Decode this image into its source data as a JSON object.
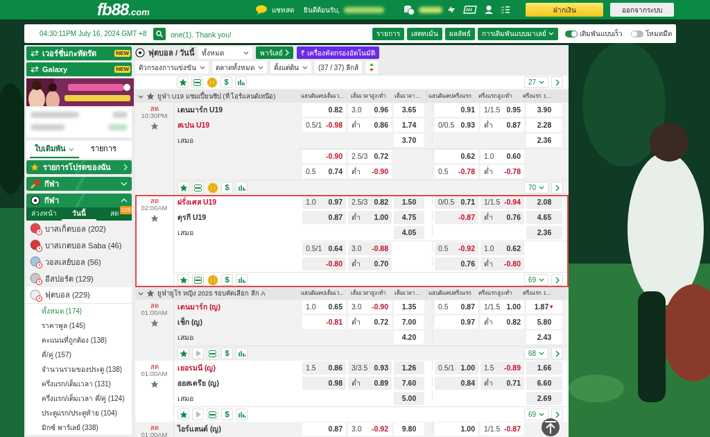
{
  "header": {
    "logo": {
      "main": "fb88",
      "suffix": ".com"
    },
    "chat": "แชทสด",
    "welcome": "ยินดีต้อนรับ,",
    "deposit": "ฝากเงิน",
    "logout": "ออกจากระบบ"
  },
  "topbar": {
    "clock": "04:30:11PM July 16, 2024 GMT +8",
    "marquee": "one(1). Thank you!",
    "buttons": [
      "รายการ",
      "เสตทเม้น",
      "ผลลัพธ์"
    ],
    "odds_type": "การเดิมพันแบบมาเลย์",
    "toggles": [
      {
        "label": "เดิมพันแบบเร็ว",
        "on": true
      },
      {
        "label": "โหมดมืด",
        "on": false
      }
    ]
  },
  "sidebar": {
    "promos": [
      {
        "label": "เวอร์ชั่นกะทัดรัด",
        "badge": "NEW"
      },
      {
        "label": "Galaxy",
        "badge": "NEW"
      }
    ],
    "slip_tabs": [
      {
        "label": "ใบเดิมพัน",
        "selected": true
      },
      {
        "label": "รายการ",
        "selected": false
      }
    ],
    "panels": [
      {
        "label": "รายการโปรดของฉัน",
        "kind": "link"
      },
      {
        "label": "กีฬา",
        "kind": "collapsible",
        "expanded": false
      },
      {
        "label": "กีฬา",
        "kind": "collapsible",
        "expanded": true
      }
    ],
    "period_tabs": [
      {
        "label": "ล่วงหน้า",
        "selected": false
      },
      {
        "label": "วันนี้",
        "selected": true
      },
      {
        "label": "สด",
        "selected": false,
        "badge": "125"
      }
    ],
    "sports": [
      {
        "name": "บาสเก็ตบอล",
        "count": "(202)",
        "expanded": false
      },
      {
        "name": "บาสเกตบอล Saba",
        "count": "(46)",
        "expanded": false
      },
      {
        "name": "วอลเลย์บอล",
        "count": "(56)",
        "expanded": false
      },
      {
        "name": "อีสปอร์ต",
        "count": "(129)",
        "expanded": false
      },
      {
        "name": "ฟุตบอล",
        "count": "(229)",
        "expanded": true,
        "children": [
          {
            "label": "ทั้งหมด (174)",
            "selected": true
          },
          {
            "label": "ราคาพูล (145)",
            "selected": false
          },
          {
            "label": "คะแนนที่ถูกต้อง (138)",
            "selected": false
          },
          {
            "label": "คี่/คู่ (157)",
            "selected": false
          },
          {
            "label": "จำนวนรวมของประตู (138)",
            "selected": false
          },
          {
            "label": "ครึ่งแรก/เต็มเวลา (131)",
            "selected": false
          },
          {
            "label": "ครึ่งแรก/เต็มเวลา คี่/คู่ (124)",
            "selected": false
          },
          {
            "label": "ประตูแรก/ประตูท้าย (104)",
            "selected": false
          },
          {
            "label": "มิกซ์ พาร์เลย์ (338)",
            "selected": false
          }
        ]
      }
    ]
  },
  "filters": {
    "sport_title": "ฟุตบอล / วันนี้",
    "market_select": "ทั้งหมด",
    "parlay": "พาร์เลย์",
    "auto_filter_symbol": "₹",
    "auto_filter": "เครื่องคัดกรองอัตโนมัติ",
    "dropdowns": [
      "ตัวกรองการแข่งขัน",
      "ตลาดทั้งหมด",
      "ตั้งแต่ต้น"
    ],
    "league_count": "(37 / 37) ลีกส์"
  },
  "toolbar": {
    "price_symbol": "$",
    "page_size": "27"
  },
  "leagues": [
    {
      "name": "ยูฟ่า U19 แชมเปี้ยนชิป (ที่ ไอร์แลนด์เหนือ)",
      "columns": [
        "แฮนดิแคปเต็มเว...",
        "เต็มเวลาสูง/ต่ำ",
        "เต็มเวลา ...",
        "แฮนดิแคปครึ่งแรก",
        "ครึ่งแรกสูง/ต่ำ",
        "ครึ่งแรก 1..."
      ],
      "matches": [
        {
          "status": "สด",
          "time": "10:30PM",
          "selected": false,
          "teams": [
            {
              "name": "เดนมาร์ก U19",
              "favorite": false
            },
            {
              "name": "สเปน U19",
              "favorite": true
            }
          ],
          "draw": "เสมอ",
          "streaming": false,
          "cash_out": true,
          "price_symbol": "$",
          "markets": "70",
          "blocks": [
            [
              {
                "ft_hdp": {
                  "odds": "0.82",
                  "negative": false
                },
                "ft_ou": {
                  "line": "3.0",
                  "odds": "0.96",
                  "negative": false
                },
                "ft_1x2": {
                  "odds": "3.65",
                  "negative": false
                },
                "ht_hdp": {
                  "odds": "0.91",
                  "negative": false
                },
                "ht_ou": {
                  "line": "1/1.5",
                  "odds": "0.95",
                  "negative": false
                },
                "ht_1x2": {
                  "odds": "3.90",
                  "negative": false
                }
              },
              {
                "ft_hdp": {
                  "line": "0.5/1",
                  "odds": "-0.98",
                  "negative": true
                },
                "ft_ou": {
                  "line": "ต่ำ",
                  "odds": "0.86",
                  "negative": false
                },
                "ft_1x2": {
                  "odds": "1.74",
                  "negative": false
                },
                "ht_hdp": {
                  "line": "0/0.5",
                  "odds": "0.93",
                  "negative": false
                },
                "ht_ou": {
                  "line": "ต่ำ",
                  "odds": "0.87",
                  "negative": false
                },
                "ht_1x2": {
                  "odds": "2.28",
                  "negative": false
                }
              },
              {
                "ft_1x2": {
                  "odds": "3.70",
                  "negative": false
                },
                "ht_1x2": {
                  "odds": "2.36",
                  "negative": false
                }
              }
            ],
            [
              {
                "ft_hdp": {
                  "odds": "-0.90",
                  "negative": true
                },
                "ft_ou": {
                  "line": "2.5/3",
                  "odds": "0.72",
                  "negative": false
                },
                "ht_hdp": {
                  "odds": "0.62",
                  "negative": false
                },
                "ht_ou": {
                  "line": "1.0",
                  "odds": "0.60",
                  "negative": false
                }
              },
              {
                "ft_hdp": {
                  "line": "0.5",
                  "odds": "0.74",
                  "negative": false
                },
                "ft_ou": {
                  "line": "ต่ำ",
                  "odds": "-0.90",
                  "negative": true
                },
                "ht_hdp": {
                  "line": "0.5",
                  "odds": "-0.78",
                  "negative": true
                },
                "ht_ou": {
                  "line": "ต่ำ",
                  "odds": "-0.78",
                  "negative": true
                }
              }
            ]
          ]
        },
        {
          "status": "สด",
          "time": "02:00AM",
          "selected": true,
          "teams": [
            {
              "name": "ฝรั่งเศส U19",
              "favorite": true
            },
            {
              "name": "ตุรกี U19",
              "favorite": false
            }
          ],
          "draw": "เสมอ",
          "streaming": false,
          "cash_out": true,
          "price_symbol": "$",
          "markets": "69",
          "blocks": [
            [
              {
                "ft_hdp": {
                  "line": "1.0",
                  "odds": "0.97",
                  "negative": false
                },
                "ft_ou": {
                  "line": "2.5/3",
                  "odds": "0.82",
                  "negative": false
                },
                "ft_1x2": {
                  "odds": "1.50",
                  "negative": false
                },
                "ht_hdp": {
                  "line": "0/0.5",
                  "odds": "0.71",
                  "negative": false
                },
                "ht_ou": {
                  "line": "1/1.5",
                  "odds": "-0.94",
                  "negative": true
                },
                "ht_1x2": {
                  "odds": "2.08",
                  "negative": false
                }
              },
              {
                "ft_hdp": {
                  "odds": "0.87",
                  "negative": false
                },
                "ft_ou": {
                  "line": "ต่ำ",
                  "odds": "1.00",
                  "negative": false
                },
                "ft_1x2": {
                  "odds": "4.75",
                  "negative": false
                },
                "ht_hdp": {
                  "odds": "-0.87",
                  "negative": true
                },
                "ht_ou": {
                  "line": "ต่ำ",
                  "odds": "0.76",
                  "negative": false
                },
                "ht_1x2": {
                  "odds": "4.65",
                  "negative": false
                }
              },
              {
                "ft_1x2": {
                  "odds": "4.05",
                  "negative": false
                },
                "ht_1x2": {
                  "odds": "2.36",
                  "negative": false
                }
              }
            ],
            [
              {
                "ft_hdp": {
                  "line": "0.5/1",
                  "odds": "0.64",
                  "negative": false
                },
                "ft_ou": {
                  "line": "3.0",
                  "odds": "-0.88",
                  "negative": true
                },
                "ht_hdp": {
                  "line": "0.5",
                  "odds": "-0.92",
                  "negative": true
                },
                "ht_ou": {
                  "line": "1.0",
                  "odds": "0.62",
                  "negative": false
                }
              },
              {
                "ft_hdp": {
                  "odds": "-0.80",
                  "negative": true
                },
                "ft_ou": {
                  "line": "ต่ำ",
                  "odds": "0.70",
                  "negative": false
                },
                "ht_hdp": {
                  "odds": "0.76",
                  "negative": false
                },
                "ht_ou": {
                  "line": "ต่ำ",
                  "odds": "-0.80",
                  "negative": true
                }
              }
            ]
          ]
        }
      ]
    },
    {
      "name": "ยูฟ่ายูโร หญิง 2025 รอบคัดเลือก ลีก A",
      "columns": [
        "แฮนดิแคปเต็มเว...",
        "เต็มเวลาสูง/ต่ำ",
        "เต็มเวลา ...",
        "แฮนดิแคปครึ่งแรก",
        "ครึ่งแรกสูง/ต่ำ",
        "ครึ่งแรก 1..."
      ],
      "matches": [
        {
          "status": "สด",
          "time": "01:00AM",
          "selected": false,
          "teams": [
            {
              "name": "เดนมาร์ก (ญ)",
              "favorite": true
            },
            {
              "name": "เช็ก (ญ)",
              "favorite": false
            }
          ],
          "draw": "เสมอ",
          "streaming": true,
          "cash_out": false,
          "price_symbol": "$",
          "markets": "68",
          "blocks": [
            [
              {
                "ft_hdp": {
                  "line": "1.0",
                  "odds": "0.65",
                  "negative": false
                },
                "ft_ou": {
                  "line": "3.0",
                  "odds": "-0.90",
                  "negative": true
                },
                "ft_1x2": {
                  "odds": "1.35",
                  "negative": false
                },
                "ht_hdp": {
                  "line": "0.5",
                  "odds": "0.87",
                  "negative": false
                },
                "ht_ou": {
                  "line": "1/1.5",
                  "odds": "1.00",
                  "negative": false
                },
                "ht_1x2": {
                  "odds": "1.87",
                  "negative": false,
                  "trend": "▼"
                }
              },
              {
                "ft_hdp": {
                  "odds": "-0.81",
                  "negative": true
                },
                "ft_ou": {
                  "line": "ต่ำ",
                  "odds": "0.72",
                  "negative": false
                },
                "ft_1x2": {
                  "odds": "7.00",
                  "negative": false
                },
                "ht_hdp": {
                  "odds": "0.97",
                  "negative": false
                },
                "ht_ou": {
                  "line": "ต่ำ",
                  "odds": "0.82",
                  "negative": false
                },
                "ht_1x2": {
                  "odds": "5.80",
                  "negative": false
                }
              },
              {
                "ft_1x2": {
                  "odds": "4.20",
                  "negative": false
                },
                "ht_1x2": {
                  "odds": "2.43",
                  "negative": false
                }
              }
            ]
          ]
        },
        {
          "status": "สด",
          "time": "01:00AM",
          "selected": false,
          "teams": [
            {
              "name": "เยอรมนี (ญ)",
              "favorite": true
            },
            {
              "name": "ออสเตรีย (ญ)",
              "favorite": false
            }
          ],
          "draw": "เสมอ",
          "streaming": true,
          "cash_out": false,
          "price_symbol": "$",
          "markets": "69",
          "blocks": [
            [
              {
                "ft_hdp": {
                  "line": "1.5",
                  "odds": "0.86",
                  "negative": false
                },
                "ft_ou": {
                  "line": "3/3.5",
                  "odds": "0.93",
                  "negative": false
                },
                "ft_1x2": {
                  "odds": "1.26",
                  "negative": false
                },
                "ht_hdp": {
                  "line": "0.5/1",
                  "odds": "1.00",
                  "negative": false
                },
                "ht_ou": {
                  "line": "1.5",
                  "odds": "-0.89",
                  "negative": true
                },
                "ht_1x2": {
                  "odds": "1.66",
                  "negative": false
                }
              },
              {
                "ft_hdp": {
                  "odds": "0.98",
                  "negative": false
                },
                "ft_ou": {
                  "line": "ต่ำ",
                  "odds": "0.89",
                  "negative": false
                },
                "ft_1x2": {
                  "odds": "7.60",
                  "negative": false
                },
                "ht_hdp": {
                  "odds": "0.84",
                  "negative": false
                },
                "ht_ou": {
                  "line": "ต่ำ",
                  "odds": "0.71",
                  "negative": false
                },
                "ht_1x2": {
                  "odds": "6.60",
                  "negative": false
                }
              },
              {
                "ft_1x2": {
                  "odds": "5.00",
                  "negative": false
                },
                "ht_1x2": {
                  "odds": "2.69",
                  "negative": false
                }
              }
            ]
          ]
        },
        {
          "status": "สด",
          "time": "01:00AM",
          "selected": false,
          "teams": [
            {
              "name": "ไอร์แลนด์ (ญ)",
              "favorite": false
            }
          ],
          "blocks": [
            [
              {
                "ft_hdp": {
                  "odds": "0.87",
                  "negative": false
                },
                "ft_ou": {
                  "line": "3.0",
                  "odds": "-0.92",
                  "negative": true
                },
                "ft_1x2": {
                  "odds": "9.80",
                  "negative": false
                },
                "ht_hdp": {
                  "odds": "1.00",
                  "negative": false
                },
                "ht_ou": {
                  "line": "1/1.5",
                  "odds": "-0.87",
                  "negative": true
                }
              }
            ]
          ]
        }
      ]
    }
  ]
}
